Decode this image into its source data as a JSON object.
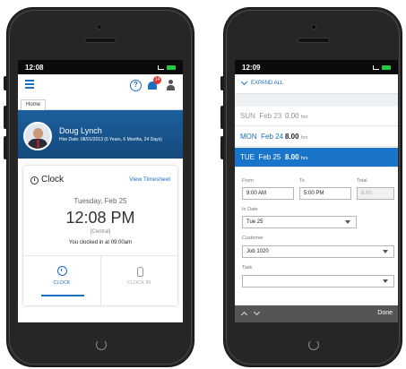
{
  "left_phone": {
    "status_time": "12:08",
    "tab": "Home",
    "notification_count": "14",
    "profile": {
      "name": "Doug Lynch",
      "hire_date": "Hire Date: 08/01/2013 (6 Years, 6 Months, 24 Days)"
    },
    "clock_card": {
      "title": "Clock",
      "view_timesheet": "View Timesheet",
      "date": "Tuesday, Feb 25",
      "time": "12:08 PM",
      "location": "[Central]",
      "status": "You clocked in at 09:00am",
      "actions": [
        {
          "label": "CLOCK",
          "icon": "clock-icon"
        },
        {
          "label": "CLOCK IN",
          "icon": "hand-tap-icon"
        }
      ]
    },
    "colors": {
      "primary": "#1a6fc4",
      "hero": "#1c5f9e"
    }
  },
  "right_phone": {
    "status_time": "12:09",
    "expand_all": "EXPAND ALL",
    "days": [
      {
        "day": "SUN",
        "date": "Feb 23",
        "hours": "0.00",
        "unit": "hrs"
      },
      {
        "day": "MON",
        "date": "Feb 24",
        "hours": "8.00",
        "unit": "hrs"
      },
      {
        "day": "TUE",
        "date": "Feb 25",
        "hours": "8.00",
        "unit": "hrs"
      }
    ],
    "selected_day_index": 2,
    "form": {
      "from_label": "From",
      "from_value": "9:00 AM",
      "to_label": "To",
      "to_value": "5:00 PM",
      "total_label": "Total",
      "total_value": "8.00",
      "in_date_label": "In Date",
      "in_date_value": "Tue 25",
      "customer_label": "Customer",
      "customer_value": "Job 1020",
      "task_label": "Task",
      "task_value": ""
    },
    "done_label": "Done",
    "colors": {
      "selected_row": "#1a74c9"
    }
  }
}
